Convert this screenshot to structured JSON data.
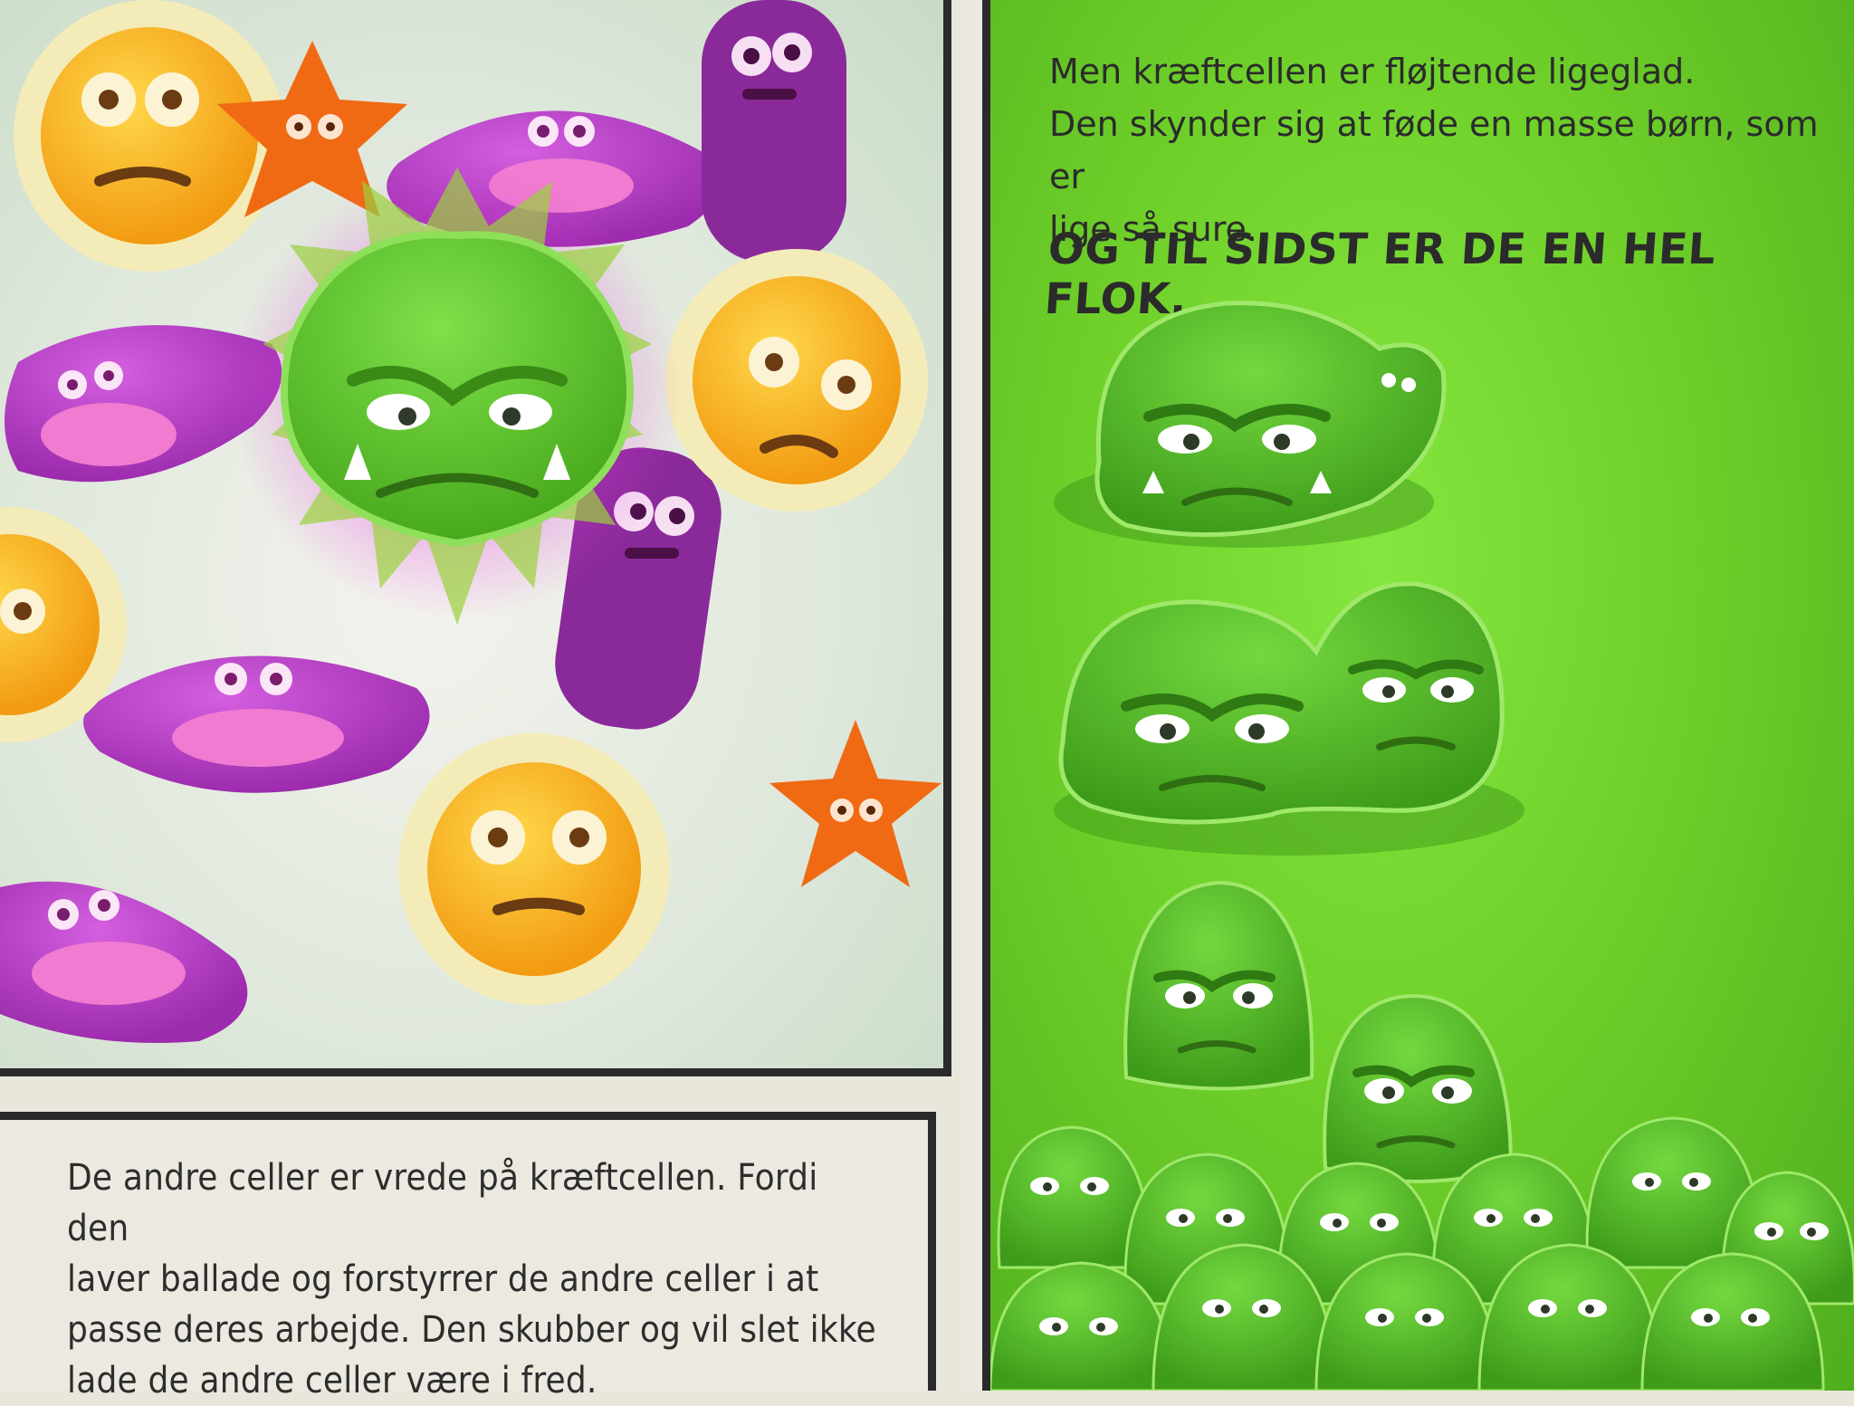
{
  "left_caption": {
    "lines": [
      "De andre celler er vrede på kræftcellen. Fordi den",
      "laver ballade og forstyrrer de andre celler i at",
      "passe deres arbejde. Den skubber og vil slet ikke",
      "lade de andre celler være i fred."
    ]
  },
  "right_story": {
    "lines": [
      "Men kræftcellen er fløjtende ligeglad.",
      "Den skynder sig at føde en masse børn, som er",
      "lige så sure."
    ],
    "headline": "OG TIL SIDST ER DE EN HEL FLOK."
  },
  "colors": {
    "cancer_green": "#5cc02a",
    "panel_border": "#2b2b2b",
    "yellow_cell": "#f4b81f",
    "purple_cell": "#b23cc0",
    "orange_star": "#f06a14"
  },
  "icons": [
    "cancer-cell-icon",
    "yellow-cell-icon",
    "purple-cell-icon",
    "rod-cell-icon",
    "star-cell-icon"
  ]
}
